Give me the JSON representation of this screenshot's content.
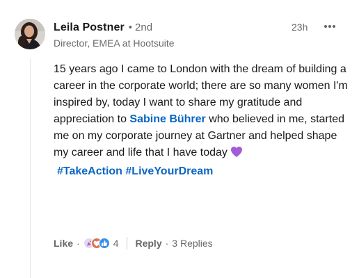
{
  "comment": {
    "author": {
      "name": "Leila Postner",
      "degree_separator": "•",
      "degree": "2nd",
      "headline": "Director, EMEA at Hootsuite"
    },
    "timestamp": "23h",
    "more_icon": "ellipsis-icon",
    "body": {
      "text_before_mention": "15 years ago I came to London with the dream of building a career in the corporate world; there are so many women I'm inspired by, today I want to share my gratitude and appreciation to ",
      "mention": "Sabine Bührer",
      "text_after_mention": " who believed in me, started me on my corporate journey at Gartner and helped shape my career and life that I have today",
      "emoji": "purple-heart",
      "hashtags": [
        "#TakeAction",
        "#LiveYourDream"
      ]
    },
    "actions": {
      "like_label": "Like",
      "dot": "·",
      "reactions": [
        "celebrate",
        "love",
        "like"
      ],
      "reaction_count": "4",
      "reply_label": "Reply",
      "replies_label": "3 Replies"
    }
  },
  "colors": {
    "link": "#0a66c2",
    "text_primary": "#191919",
    "text_secondary": "#666666",
    "heart": "#a45bd9"
  }
}
